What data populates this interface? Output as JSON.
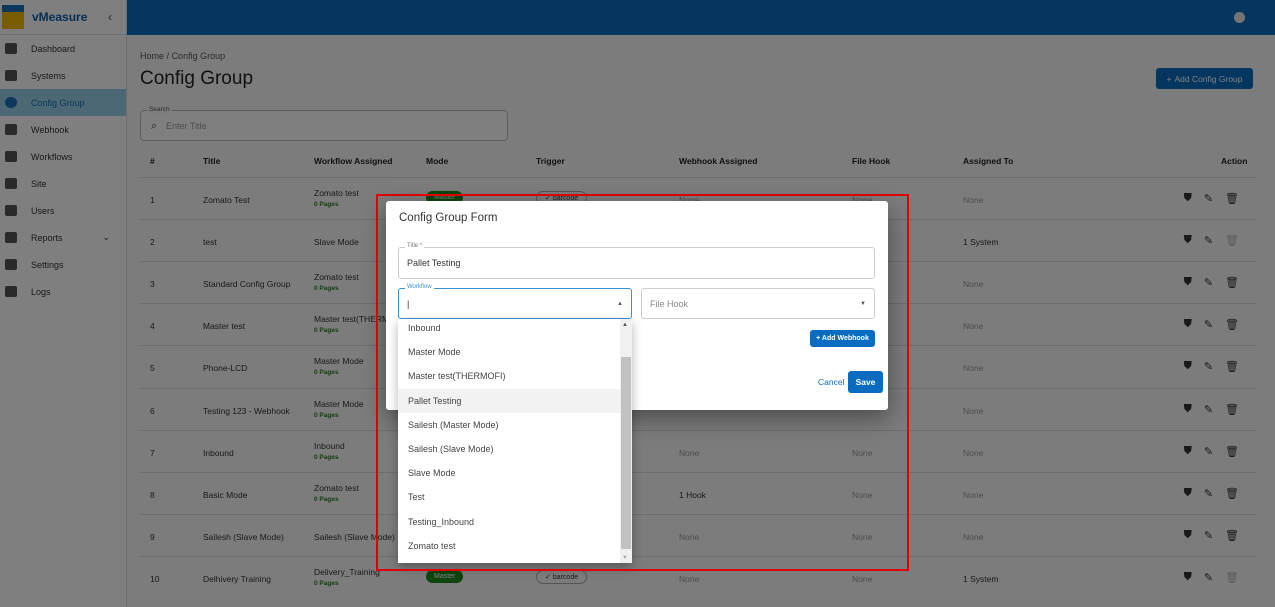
{
  "app": {
    "name": "vMeasure"
  },
  "sidebar": {
    "items": [
      {
        "label": "Dashboard",
        "icon": "dashboard-icon"
      },
      {
        "label": "Systems",
        "icon": "systems-icon"
      },
      {
        "label": "Config Group",
        "icon": "config-icon",
        "active": true
      },
      {
        "label": "Webhook",
        "icon": "webhook-icon"
      },
      {
        "label": "Workflows",
        "icon": "workflows-icon"
      },
      {
        "label": "Site",
        "icon": "location-icon"
      },
      {
        "label": "Users",
        "icon": "users-icon"
      },
      {
        "label": "Reports",
        "icon": "reports-icon",
        "expandable": true
      },
      {
        "label": "Settings",
        "icon": "gear-icon"
      },
      {
        "label": "Logs",
        "icon": "logs-icon"
      }
    ]
  },
  "breadcrumb": {
    "home": "Home",
    "sep": "/",
    "current": "Config Group"
  },
  "page": {
    "title": "Config Group",
    "add_button": "Add Config Group"
  },
  "search": {
    "label": "Search",
    "placeholder": "Enter Title"
  },
  "table": {
    "headers": [
      "#",
      "Title",
      "Workflow Assigned",
      "Mode",
      "Trigger",
      "Webhook Assigned",
      "File Hook",
      "Assigned To",
      "Action"
    ],
    "rows": [
      {
        "n": "1",
        "title": "Zomato Test",
        "workflow": "Zomato test",
        "pages": "0 Pages",
        "mode": "Master",
        "trigger": "barcode",
        "webhook": "None",
        "filehook": "None",
        "assigned": "None",
        "delete_disabled": false
      },
      {
        "n": "2",
        "title": "test",
        "workflow": "Slave Mode",
        "pages": "",
        "assigned": "1 System",
        "delete_disabled": true
      },
      {
        "n": "3",
        "title": "Standard Config Group",
        "workflow": "Zomato test",
        "pages": "0 Pages",
        "assigned": "None"
      },
      {
        "n": "4",
        "title": "Master test",
        "workflow": "Master test(THERMOFI)",
        "pages": "0 Pages",
        "assigned": "None"
      },
      {
        "n": "5",
        "title": "Phone-LCD",
        "workflow": "Master Mode",
        "pages": "0 Pages",
        "assigned": "None"
      },
      {
        "n": "6",
        "title": "Testing 123 - Webhook",
        "workflow": "Master Mode",
        "pages": "0 Pages",
        "assigned": "None"
      },
      {
        "n": "7",
        "title": "Inbound",
        "workflow": "Inbound",
        "pages": "0 Pages",
        "webhook": "None",
        "filehook": "None",
        "assigned": "None"
      },
      {
        "n": "8",
        "title": "Basic Mode",
        "workflow": "Zomato test",
        "pages": "0 Pages",
        "webhook": "1 Hook",
        "filehook": "None",
        "assigned": "None"
      },
      {
        "n": "9",
        "title": "Sailesh (Slave Mode)",
        "workflow": "Sailesh (Slave Mode)",
        "pages": "",
        "webhook": "None",
        "filehook": "None",
        "assigned": "None"
      },
      {
        "n": "10",
        "title": "Delhivery Training",
        "workflow": "Delivery_Training",
        "pages": "0 Pages",
        "mode": "Master",
        "trigger": "barcode",
        "webhook": "None",
        "filehook": "None",
        "assigned": "1 System",
        "delete_disabled": true
      }
    ]
  },
  "modal": {
    "title": "Config Group Form",
    "title_label": "Title *",
    "title_value": "Pallet Testing",
    "workflow_label": "Workflow",
    "workflow_value": "",
    "filehook_placeholder": "File Hook",
    "add_webhook": "+ Add Webhook",
    "cancel": "Cancel",
    "save": "Save",
    "workflow_options": [
      "Inbound",
      "Master Mode",
      "Master test(THERMOFI)",
      "Pallet Testing",
      "Sailesh (Master Mode)",
      "Sailesh (Slave Mode)",
      "Slave Mode",
      "Test",
      "Testing_Inbound",
      "Zomato test"
    ],
    "highlighted": "Pallet Testing"
  },
  "colors": {
    "primary": "#0a6cc0",
    "mode_badge": "#1f8a1f",
    "highlight_box": "#e00000"
  }
}
